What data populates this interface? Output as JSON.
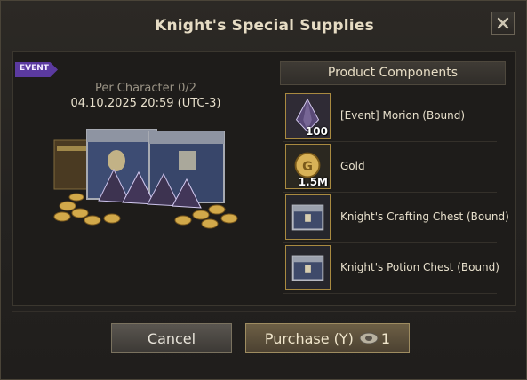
{
  "dialog": {
    "title": "Knight's Special Supplies"
  },
  "product": {
    "event_tag": "EVENT",
    "per_character": "Per Character 0/2",
    "date": "04.10.2025 20:59 (UTC-3)"
  },
  "components": {
    "header": "Product Components",
    "items": [
      {
        "name": "[Event] Morion (Bound)",
        "qty": "100",
        "icon": "morion-crystal-icon"
      },
      {
        "name": "Gold",
        "qty": "1.5M",
        "icon": "gold-coin-icon"
      },
      {
        "name": "Knight's Crafting Chest (Bound)",
        "qty": "",
        "icon": "chest-icon"
      },
      {
        "name": "Knight's Potion Chest (Bound)",
        "qty": "",
        "icon": "chest-icon"
      }
    ]
  },
  "buttons": {
    "cancel": "Cancel",
    "purchase": "Purchase (Y)",
    "price": "1"
  },
  "colors": {
    "event_tag": "#5b3aa0",
    "icon_border": "#a98a40",
    "purchase_bg": "#6d5f45"
  }
}
